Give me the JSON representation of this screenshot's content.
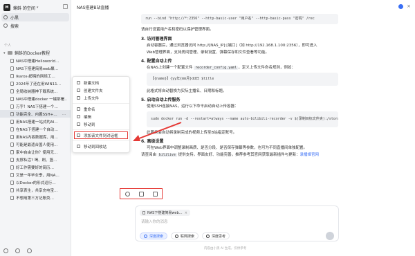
{
  "sidebar": {
    "workspace_name": "蝌蚪 的空间",
    "workspace_caret": "▾",
    "workspace_logo": "M",
    "nav": [
      {
        "label": "小黑",
        "icon": "user-icon"
      },
      {
        "label": "搜索",
        "icon": "search-icon"
      }
    ],
    "section_label": "个人",
    "folder": {
      "caret": "▾",
      "label": "蝌蚪的Docker教程"
    },
    "docs": [
      {
        "label": "NAS中搭建Helloworld…"
      },
      {
        "label": "NAS下搭建简易web聚…"
      },
      {
        "label": "Ikaros-超嗨的网络工…"
      },
      {
        "label": "2024年了还在用WIN11…"
      },
      {
        "label": "全局收纳器神下载系统…"
      },
      {
        "label": "NAS中搭建docker 一键部署…"
      },
      {
        "label": "万字！NAS下搭建一个…"
      },
      {
        "label": "功能完全、内置SSH+…"
      },
      {
        "label": "用NAS搭建一站式的AI…"
      },
      {
        "label": "在NAS下搭建一个自动…"
      },
      {
        "label": "用NAS内容数据库、用…"
      },
      {
        "label": "可能是最适合国人使用…"
      },
      {
        "label": "家中自由让你？使用无…"
      },
      {
        "label": "支撑私活? 喝、刷、篮…"
      },
      {
        "label": "好工作需要好的简历…"
      },
      {
        "label": "又是一年毕业季，用NA…"
      },
      {
        "label": "以Docker的形式运行…"
      },
      {
        "label": "共享表生，共享充电宝…"
      },
      {
        "label": "不想用第三方记账类…"
      }
    ],
    "highlighted_index": 7,
    "dots": "…"
  },
  "context_menu": {
    "items": [
      {
        "label": "新建文档"
      },
      {
        "label": "创建文件夹"
      },
      {
        "label": "上传文件"
      },
      {
        "label": "重命名"
      },
      {
        "label": "编辑"
      },
      {
        "label": "移动到"
      },
      {
        "label": "添加该文件到对话框"
      },
      {
        "label": "移动到回收站"
      }
    ]
  },
  "main": {
    "title": "NAS搭建B站直播",
    "code1": "run --bind \"http://*:2356\" --http-basic-user \"用户名\" --http-basic-pass \"密码\" /rec",
    "p1": "请自行设置用户名和密码以保护管理界面。",
    "s3_title": "3. 访问管理界面",
    "s3_l1": "启动容器后，通过浏览器访问 http://[NAS_IP]:[端口]（如 http://192.168.1.100:2356），即可进入",
    "s3_l2": "Web管理界面，支持房间管理、录制设置、弹幕保存和文件查看等功能。",
    "s4_title": "4. 配置自动上传",
    "s4_l1_a": "在NAS上创建一个配置文件 ",
    "s4_l1_code": "recorder_config.yaml",
    "s4_l1_b": "，定义上传文件命名规则，例如：",
    "code2": "【{name}】{yy年{mm月}dd日 $title",
    "s4_l2": "此格式将自动替换为实际主播名、日期和标题。",
    "s5_title": "5. 启动自动上传服务",
    "s5_l1": "使用SSH连接NAS，运行以下命令启动自动上传容器：",
    "code3": "sudo docker run -d --restart=always --name auto-bilibili-recorder -v $(录制目标文件夹):/storage g",
    "s5_l2": "此服务会自动将录制完成的视频上传至B站指定账号。",
    "s6_title": "6. 高级设置",
    "s6_l1": "可在Web界面中调整录制画质、是否分段、是否保存弹幕等参数，也可为不同直播间单独配置。",
    "s6_l2_a": "请查阅由 ",
    "s6_l2_code": "bililive",
    "s6_l2_b": " 提供支持，界面友好、功能完善，推荐参考其官网获取最新插件与更新：",
    "s6_link": "录播姬官网"
  },
  "composer": {
    "chip_label": "NAS下搭建简易web…",
    "chip_close": "×",
    "placeholder": "请输入你的消息",
    "tools": [
      {
        "label": "深度搜索",
        "on": true
      },
      {
        "label": "联网搜索",
        "on": false
      },
      {
        "label": "深度思考",
        "on": false
      }
    ],
    "footer": "内容由小黑 AI 生成，仅供参考"
  },
  "colors": {
    "accent": "#3a6ff5",
    "annotation_red": "#e53935"
  }
}
